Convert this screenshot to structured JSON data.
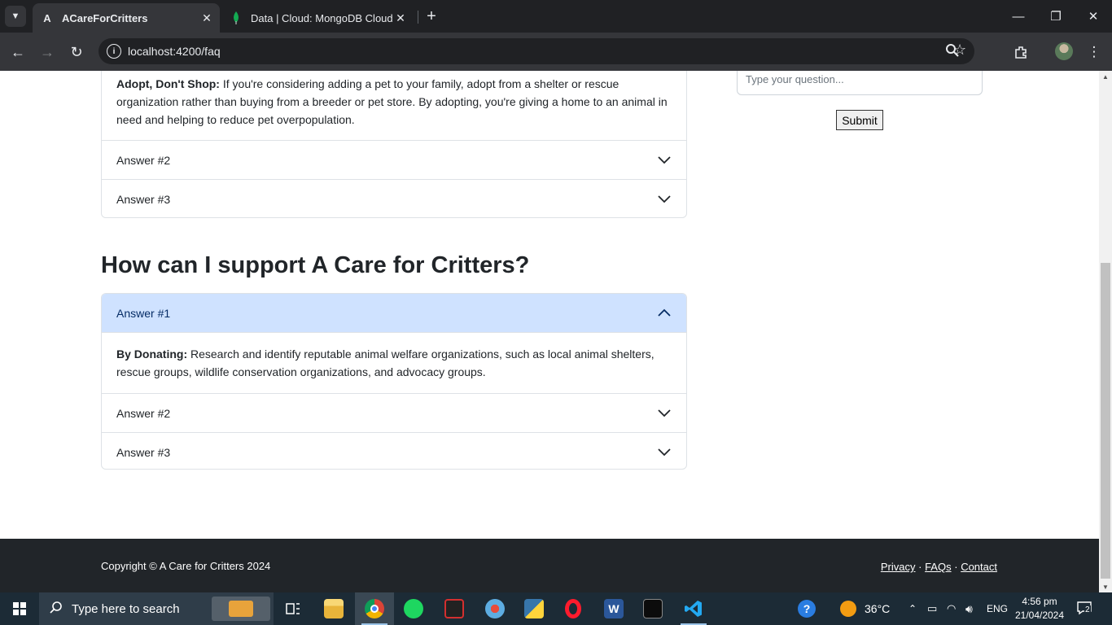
{
  "browser": {
    "tabs": [
      {
        "title": "ACareForCritters",
        "favicon": "A",
        "active": true
      },
      {
        "title": "Data | Cloud: MongoDB Cloud",
        "favicon": "mongodb-leaf",
        "active": false
      }
    ],
    "url": "localhost:4200/faq"
  },
  "page": {
    "first_accordion": {
      "open_body_bold": "Adopt, Don't Shop:",
      "open_body_text": " If you're considering adding a pet to your family, adopt from a shelter or rescue organization rather than buying from a breeder or pet store. By adopting, you're giving a home to an animal in need and helping to reduce pet overpopulation.",
      "items": [
        "Answer #2",
        "Answer #3"
      ]
    },
    "section_title": "How can I support A Care for Critters?",
    "second_accordion": {
      "open_header": "Answer #1",
      "open_body_bold": "By Donating:",
      "open_body_text": " Research and identify reputable animal welfare organizations, such as local animal shelters, rescue groups, wildlife conservation organizations, and advocacy groups.",
      "items": [
        "Answer #2",
        "Answer #3"
      ]
    },
    "question_form": {
      "placeholder": "Type your question...",
      "submit_label": "Submit"
    },
    "footer": {
      "copyright": "Copyright © A Care for Critters 2024",
      "links": [
        "Privacy",
        "FAQs",
        "Contact"
      ],
      "separator": "·"
    }
  },
  "taskbar": {
    "search_placeholder": "Type here to search",
    "weather": "36°C",
    "language": "ENG",
    "time": "4:56 pm",
    "date": "21/04/2024",
    "notification_count": "2"
  },
  "colors": {
    "accordion_open_bg": "#cfe2ff",
    "footer_bg": "#212529",
    "browser_dark": "#202124"
  }
}
